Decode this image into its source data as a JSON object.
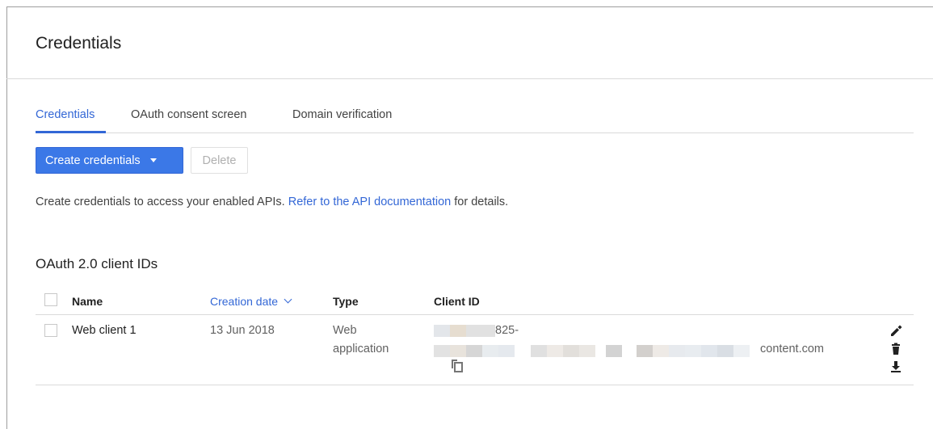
{
  "header": {
    "title": "Credentials"
  },
  "tabs": [
    {
      "label": "Credentials"
    },
    {
      "label": "OAuth consent screen"
    },
    {
      "label": "Domain verification"
    }
  ],
  "toolbar": {
    "create_label": "Create credentials",
    "delete_label": "Delete"
  },
  "info": {
    "prefix": "Create credentials to access your enabled APIs.",
    "link": "Refer to the API documentation",
    "suffix": "for details."
  },
  "oauth_section": {
    "title": "OAuth 2.0 client IDs",
    "columns": {
      "name": "Name",
      "creation_date": "Creation date",
      "type": "Type",
      "client_id": "Client ID"
    },
    "rows": [
      {
        "name": "Web client 1",
        "creation_date": "13 Jun 2018",
        "type_line1": "Web",
        "type_line2": "application",
        "client_id_visible_part1": "825-",
        "client_id_visible_part2": "content.com"
      }
    ]
  },
  "icons": [
    "dropdown-caret-icon",
    "sort-chevron-icon",
    "copy-icon",
    "edit-icon",
    "delete-icon",
    "download-icon"
  ],
  "colors": {
    "accent": "#3367d6",
    "button": "#3b78e7"
  }
}
